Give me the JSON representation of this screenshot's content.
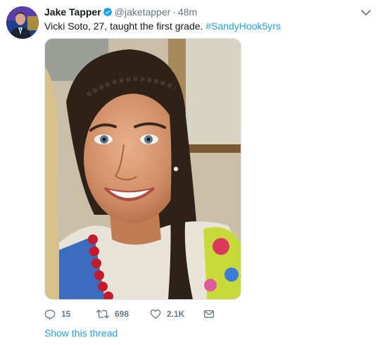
{
  "tweet": {
    "author_name": "Jake Tapper",
    "author_handle": "@jaketapper",
    "separator": "·",
    "timestamp": "48m",
    "text_before_hashtag": "Vicki Soto, 27, taught the first grade. ",
    "hashtag": "#SandyHook5yrs",
    "avatar_icon": "person-avatar",
    "verified_icon": "verified-badge-icon",
    "menu_icon": "chevron-down-icon",
    "media_description_icon": "photo"
  },
  "actions": {
    "reply_count": "15",
    "retweet_count": "698",
    "like_count": "2.1K",
    "reply_icon": "reply-icon",
    "retweet_icon": "retweet-icon",
    "like_icon": "heart-icon",
    "dm_icon": "envelope-icon"
  },
  "thread_link": "Show this thread",
  "colors": {
    "link_blue": "#1da1f2",
    "secondary_text": "#657786",
    "primary_text": "#14171a",
    "verified_blue": "#1da1f2"
  }
}
